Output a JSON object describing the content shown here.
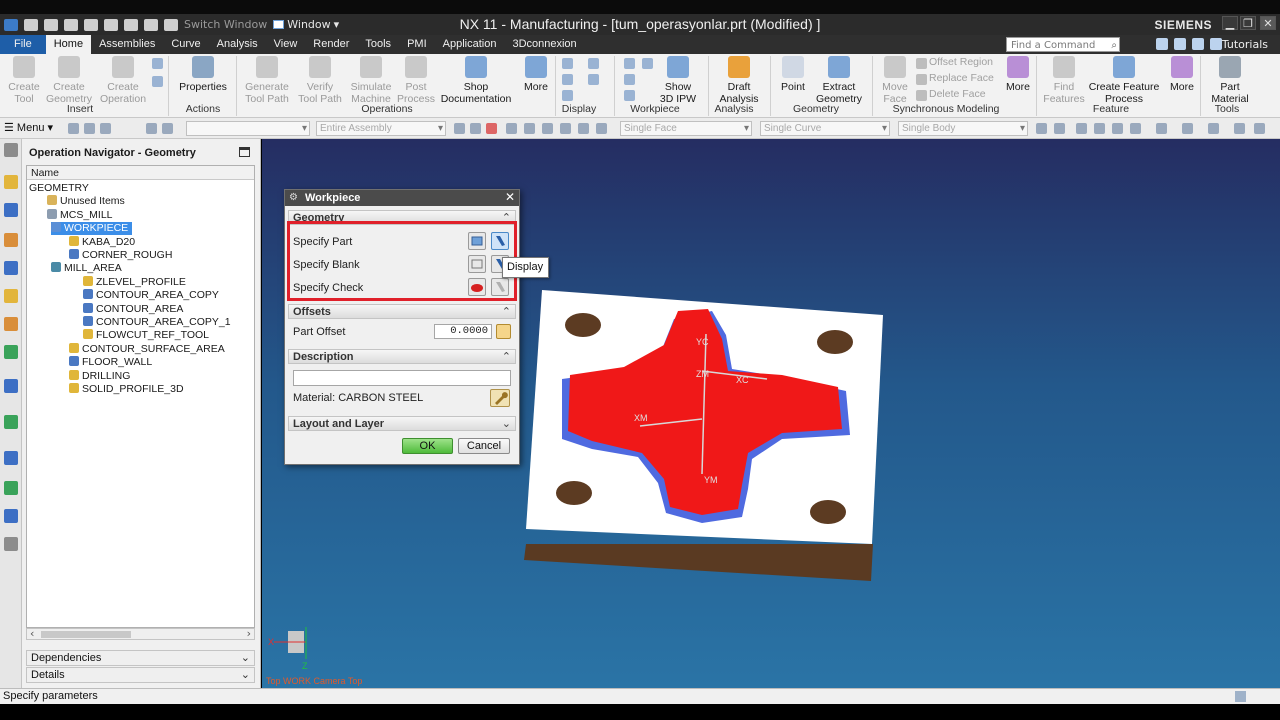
{
  "titlebar": {
    "switch_window": "Switch Window",
    "window_menu": "Window",
    "title": "NX 11 - Manufacturing - [tum_operasyonlar.prt (Modified) ]",
    "brand": "SIEMENS",
    "min": "▁",
    "restore": "❐",
    "close": "✕"
  },
  "tabs": [
    "File",
    "Home",
    "Assemblies",
    "Curve",
    "Analysis",
    "View",
    "Render",
    "Tools",
    "PMI",
    "Application",
    "3Dconnexion"
  ],
  "search": {
    "placeholder": "Find a Command"
  },
  "tutorials": "Tutorials",
  "ribbon": {
    "create_tool": [
      "Create",
      "Tool"
    ],
    "create_geometry": [
      "Create",
      "Geometry"
    ],
    "create_operation": [
      "Create",
      "Operation"
    ],
    "insert": "Insert",
    "properties": "Properties",
    "actions": "Actions",
    "generate_tool_path": [
      "Generate",
      "Tool Path"
    ],
    "verify_tool_path": [
      "Verify",
      "Tool Path"
    ],
    "simulate_machine": [
      "Simulate",
      "Machine"
    ],
    "post_process": [
      "Post",
      "Process"
    ],
    "shop_documentation": [
      "Shop",
      "Documentation"
    ],
    "operations": "Operations",
    "more": "More",
    "display": "Display",
    "show_3d_ipw": [
      "Show",
      "3D IPW"
    ],
    "workpiece_grp": "Workpiece",
    "draft_analysis": [
      "Draft",
      "Analysis"
    ],
    "analysis": "Analysis",
    "point": "Point",
    "extract_geometry": [
      "Extract",
      "Geometry"
    ],
    "geometry_grp": "Geometry",
    "move_face": [
      "Move",
      "Face"
    ],
    "offset_region": "Offset Region",
    "replace_face": "Replace Face",
    "delete_face": "Delete Face",
    "synchronous_modeling": "Synchronous Modeling",
    "find_features": [
      "Find",
      "Features"
    ],
    "create_feature_process": [
      "Create Feature",
      "Process"
    ],
    "feature": "Feature",
    "part_material": [
      "Part",
      "Material"
    ],
    "tools": "Tools"
  },
  "toolbar2": {
    "menu": "Menu",
    "filter1": "",
    "filter2": "Entire Assembly",
    "filter3": "Single Face",
    "filter4": "Single Curve",
    "filter5": "Single Body"
  },
  "navigator": {
    "title": "Operation Navigator - Geometry",
    "column": "Name",
    "rows": [
      {
        "label": "GEOMETRY",
        "indent": 0,
        "color": ""
      },
      {
        "label": "Unused Items",
        "indent": 1,
        "color": "#d9b35a"
      },
      {
        "label": "MCS_MILL",
        "indent": 1,
        "color": "#8d9db0"
      },
      {
        "label": "WORKPIECE",
        "indent": 2,
        "color": "#5b8fd6",
        "selected": true
      },
      {
        "label": "KABA_D20",
        "indent": 3,
        "color": "#e0b63a"
      },
      {
        "label": "CORNER_ROUGH",
        "indent": 3,
        "color": "#4a78c2"
      },
      {
        "label": "MILL_AREA",
        "indent": 2,
        "color": "#4a8aa6"
      },
      {
        "label": "ZLEVEL_PROFILE",
        "indent": 4,
        "color": "#e0b63a"
      },
      {
        "label": "CONTOUR_AREA_COPY",
        "indent": 4,
        "color": "#4a78c2"
      },
      {
        "label": "CONTOUR_AREA",
        "indent": 4,
        "color": "#4a78c2"
      },
      {
        "label": "CONTOUR_AREA_COPY_1",
        "indent": 4,
        "color": "#4a78c2"
      },
      {
        "label": "FLOWCUT_REF_TOOL",
        "indent": 4,
        "color": "#e0b63a"
      },
      {
        "label": "CONTOUR_SURFACE_AREA",
        "indent": 3,
        "color": "#e0b63a"
      },
      {
        "label": "FLOOR_WALL",
        "indent": 3,
        "color": "#4a78c2"
      },
      {
        "label": "DRILLING",
        "indent": 3,
        "color": "#e0b63a"
      },
      {
        "label": "SOLID_PROFILE_3D",
        "indent": 3,
        "color": "#e0b63a"
      }
    ],
    "dependencies": "Dependencies",
    "details": "Details"
  },
  "dialog": {
    "title": "Workpiece",
    "geometry": "Geometry",
    "specify_part": "Specify Part",
    "specify_blank": "Specify Blank",
    "specify_check": "Specify Check",
    "offsets": "Offsets",
    "part_offset": "Part Offset",
    "part_offset_value": "0.0000",
    "description": "Description",
    "material": "Material: CARBON STEEL",
    "layout_layer": "Layout and Layer",
    "ok": "OK",
    "cancel": "Cancel"
  },
  "tooltip": "Display",
  "viewport": {
    "label": "Top WORK Camera Top",
    "axis_labels": [
      "YC",
      "XC",
      "ZM",
      "XM",
      "YM"
    ],
    "triad_x": "X",
    "triad_z": "Z"
  },
  "status": "Specify parameters",
  "colors": {
    "part_red": "#f01818",
    "blank_white": "#ffffff",
    "base_brown": "#5a3a22",
    "blue_wall": "#4f6ae0",
    "highlight": "#e0202a"
  }
}
